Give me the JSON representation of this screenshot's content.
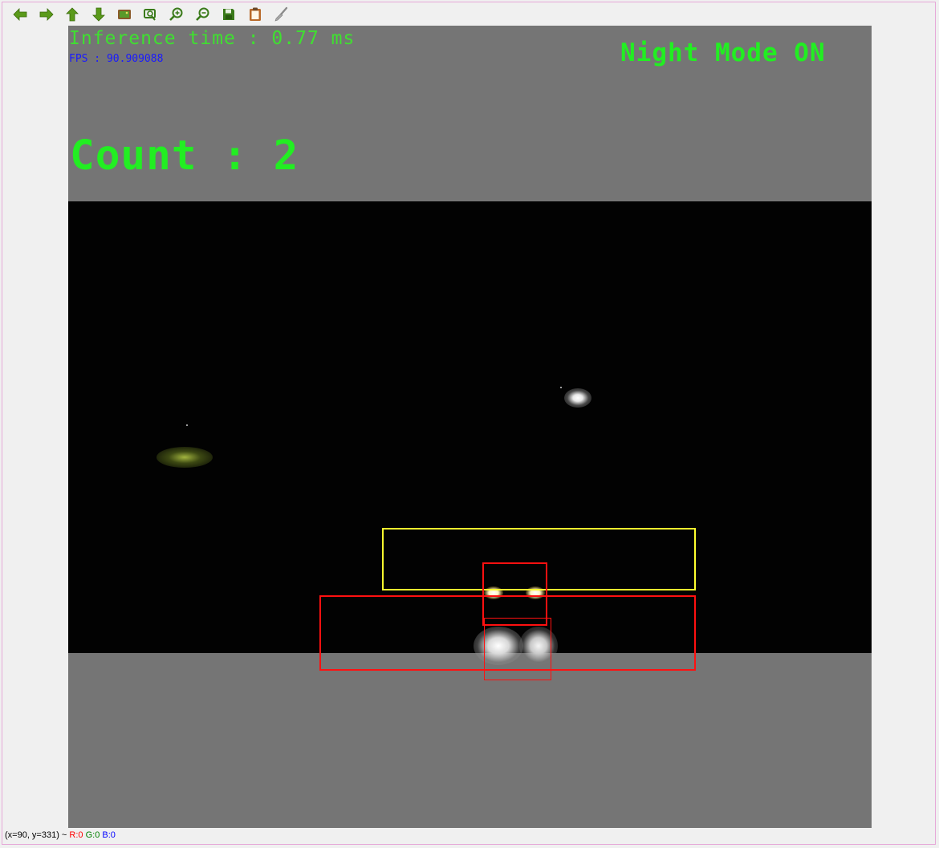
{
  "toolbar": {
    "buttons": [
      {
        "name": "pan-left-button",
        "icon": "arrow-left-icon",
        "color": "#5a9a1a"
      },
      {
        "name": "pan-right-button",
        "icon": "arrow-right-icon",
        "color": "#5a9a1a"
      },
      {
        "name": "pan-up-button",
        "icon": "arrow-up-icon",
        "color": "#5a9a1a"
      },
      {
        "name": "pan-down-button",
        "icon": "arrow-down-icon",
        "color": "#5a9a1a"
      },
      {
        "name": "zoom-to-fit-button",
        "icon": "image-fit-icon",
        "color": "#8a5a2a"
      },
      {
        "name": "zoom-original-button",
        "icon": "zoom-original-icon",
        "color": "#4a8a1a"
      },
      {
        "name": "zoom-in-button",
        "icon": "zoom-in-icon",
        "color": "#4a8a1a"
      },
      {
        "name": "zoom-out-button",
        "icon": "zoom-out-icon",
        "color": "#4a8a1a"
      },
      {
        "name": "save-button",
        "icon": "floppy-disk-icon",
        "color": "#3a7a1a"
      },
      {
        "name": "copy-to-clipboard-button",
        "icon": "clipboard-icon",
        "color": "#b86a2a"
      },
      {
        "name": "properties-button",
        "icon": "brush-icon",
        "color": "#9a9a9a"
      }
    ]
  },
  "overlay": {
    "inference_text": "Inference time : 0.77 ms",
    "fps_text": "FPS : 90.909088",
    "night_mode_text": "Night Mode ON",
    "count_text": "Count : 2"
  },
  "colors": {
    "inference": "#3fe030",
    "fps": "#1a1aff",
    "night_mode": "#22ee22",
    "count": "#22ee22",
    "box_yellow": "#ffff2e",
    "box_red": "#ff1010",
    "letterbox_gray": "#757575"
  },
  "status_bar": {
    "coords": "(x=90, y=331) ~ ",
    "r": "R:0",
    "g": "G:0",
    "b": "B:0",
    "r_color": "#ff0000",
    "g_color": "#008000",
    "b_color": "#0000ff"
  }
}
